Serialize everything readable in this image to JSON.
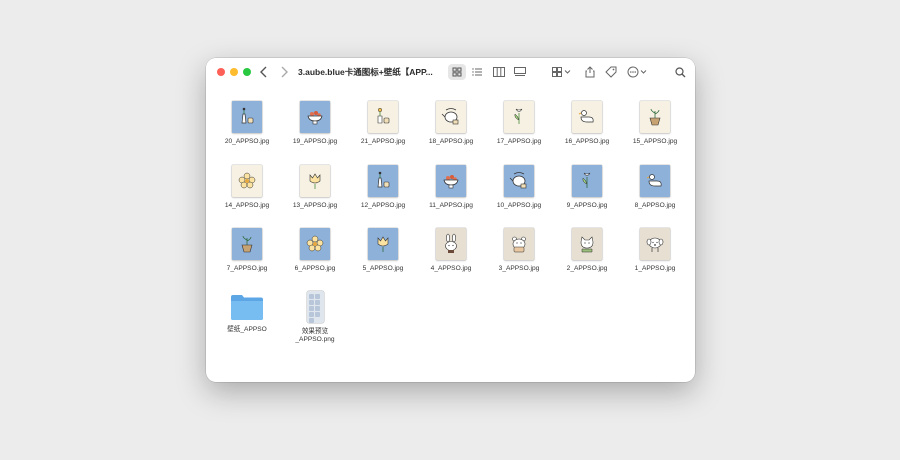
{
  "window": {
    "title": "3.aube.blue卡通图标+壁纸【APP...",
    "toolbar_icons": [
      "back-icon",
      "forward-icon",
      "icon-view",
      "list-view",
      "column-view",
      "gallery-view",
      "group-icon",
      "share-icon",
      "tag-icon",
      "more-icon",
      "search-icon"
    ]
  },
  "files": [
    {
      "name": "20_APPSO.jpg",
      "bg": "blue",
      "icon": "vase"
    },
    {
      "name": "19_APPSO.jpg",
      "bg": "blue",
      "icon": "bowl"
    },
    {
      "name": "21_APPSO.jpg",
      "bg": "cream",
      "icon": "flower-cup"
    },
    {
      "name": "18_APPSO.jpg",
      "bg": "cream",
      "icon": "teapot"
    },
    {
      "name": "17_APPSO.jpg",
      "bg": "cream",
      "icon": "tulip-leaf"
    },
    {
      "name": "16_APPSO.jpg",
      "bg": "cream",
      "icon": "duck"
    },
    {
      "name": "15_APPSO.jpg",
      "bg": "cream",
      "icon": "plant-pot"
    },
    {
      "name": "14_APPSO.jpg",
      "bg": "cream",
      "icon": "flower"
    },
    {
      "name": "13_APPSO.jpg",
      "bg": "cream",
      "icon": "tulip"
    },
    {
      "name": "12_APPSO.jpg",
      "bg": "blue",
      "icon": "vase"
    },
    {
      "name": "11_APPSO.jpg",
      "bg": "blue",
      "icon": "bowl"
    },
    {
      "name": "10_APPSO.jpg",
      "bg": "blue",
      "icon": "teapot"
    },
    {
      "name": "9_APPSO.jpg",
      "bg": "blue",
      "icon": "tulip-leaf"
    },
    {
      "name": "8_APPSO.jpg",
      "bg": "blue",
      "icon": "duck"
    },
    {
      "name": "7_APPSO.jpg",
      "bg": "blue",
      "icon": "plant-pot"
    },
    {
      "name": "6_APPSO.jpg",
      "bg": "blue",
      "icon": "flower"
    },
    {
      "name": "5_APPSO.jpg",
      "bg": "blue",
      "icon": "tulip"
    },
    {
      "name": "4_APPSO.jpg",
      "bg": "beige",
      "icon": "rabbit"
    },
    {
      "name": "3_APPSO.jpg",
      "bg": "beige",
      "icon": "bear"
    },
    {
      "name": "2_APPSO.jpg",
      "bg": "beige",
      "icon": "cat"
    },
    {
      "name": "1_APPSO.jpg",
      "bg": "beige",
      "icon": "dog"
    }
  ],
  "folder": {
    "name": "壁纸_APPSO",
    "color": "#6db1ec"
  },
  "preview": {
    "name_line1": "效果预览",
    "name_line2": "_APPSO.png"
  }
}
